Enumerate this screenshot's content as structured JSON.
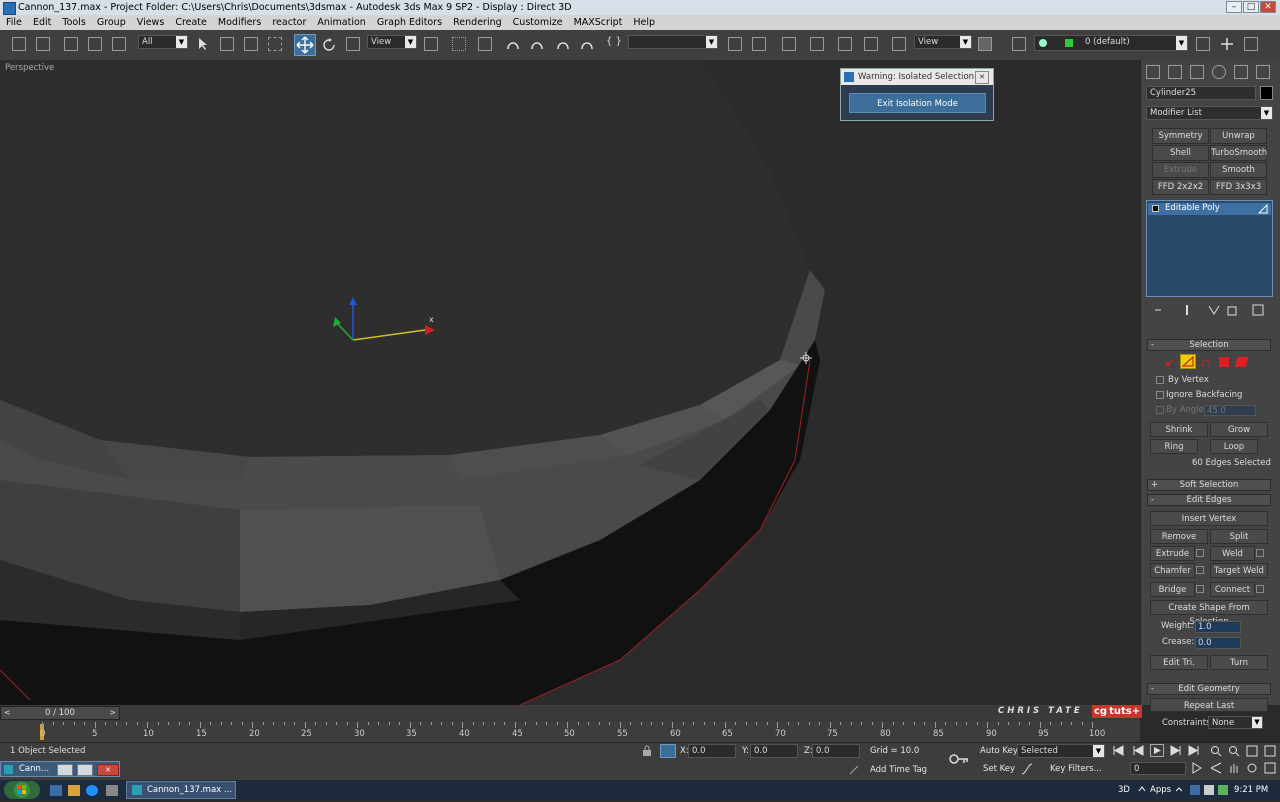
{
  "window": {
    "title": "Cannon_137.max   - Project Folder: C:\\Users\\Chris\\Documents\\3dsmax    - Autodesk 3ds Max 9 SP2    - Display : Direct 3D"
  },
  "menu": [
    "File",
    "Edit",
    "Tools",
    "Group",
    "Views",
    "Create",
    "Modifiers",
    "reactor",
    "Animation",
    "Graph Editors",
    "Rendering",
    "Customize",
    "MAXScript",
    "Help"
  ],
  "toolbar": {
    "selection_filter": "All",
    "ref_coord": "View",
    "ref_coord2": "View",
    "layer": "0 (default)"
  },
  "viewport": {
    "label": "Perspective",
    "axis_x": "x"
  },
  "dialog": {
    "title": "Warning: Isolated Selection",
    "button": "Exit Isolation Mode"
  },
  "command_panel": {
    "object_name": "Cylinder25",
    "modifier_list": "Modifier List",
    "modifier_buttons": [
      "Symmetry",
      "Unwrap UVW",
      "Shell",
      "TurboSmooth",
      "Extrude",
      "Smooth",
      "FFD 2x2x2",
      "FFD 3x3x3"
    ],
    "stack_item": "Editable Poly",
    "selection_rollout": "Selection",
    "by_vertex": "By Vertex",
    "ignore_backfacing": "Ignore Backfacing",
    "by_angle": "By Angle:",
    "by_angle_value": "45.0",
    "shrink": "Shrink",
    "grow": "Grow",
    "ring": "Ring",
    "loop": "Loop",
    "selection_status": "60 Edges Selected",
    "soft_selection": "Soft Selection",
    "edit_edges": "Edit Edges",
    "insert_vertex": "Insert Vertex",
    "remove": "Remove",
    "split": "Split",
    "extrude": "Extrude",
    "weld": "Weld",
    "chamfer": "Chamfer",
    "target_weld": "Target Weld",
    "bridge": "Bridge",
    "connect": "Connect",
    "create_shape": "Create Shape From Selection",
    "weight_label": "Weight:",
    "weight_value": "1.0",
    "crease_label": "Crease:",
    "crease_value": "0.0",
    "edit_tri": "Edit Tri.",
    "turn": "Turn",
    "edit_geometry": "Edit Geometry",
    "repeat_last": "Repeat Last",
    "constraints_label": "Constraints:",
    "constraints_value": "None",
    "rollout_signs": {
      "minus": "-",
      "plus": "+"
    }
  },
  "timeline": {
    "slider": "0 / 100",
    "ticks": [
      "0",
      "5",
      "10",
      "15",
      "20",
      "25",
      "30",
      "35",
      "40",
      "45",
      "50",
      "55",
      "60",
      "65",
      "70",
      "75",
      "80",
      "85",
      "90",
      "95",
      "100"
    ],
    "watermark": "CHRIS TATE",
    "logo1": "cg",
    "logo2": "tuts+"
  },
  "status": {
    "selected": "1 Object Selected",
    "x_label": "X:",
    "x_value": "0.0",
    "y_label": "Y:",
    "y_value": "0.0",
    "z_label": "Z:",
    "z_value": "0.0",
    "grid": "Grid = 10.0",
    "add_time_tag": "Add Time Tag",
    "auto_key": "Auto Key",
    "auto_key_mode": "Selected",
    "set_key": "Set Key",
    "key_filters": "Key Filters...",
    "frame": "0"
  },
  "mini_window": {
    "title": "Cann..."
  },
  "taskbar": {
    "app": "Cannon_137.max    ...",
    "tray_3d": "3D",
    "apps": "Apps",
    "time": "9:21 PM"
  }
}
